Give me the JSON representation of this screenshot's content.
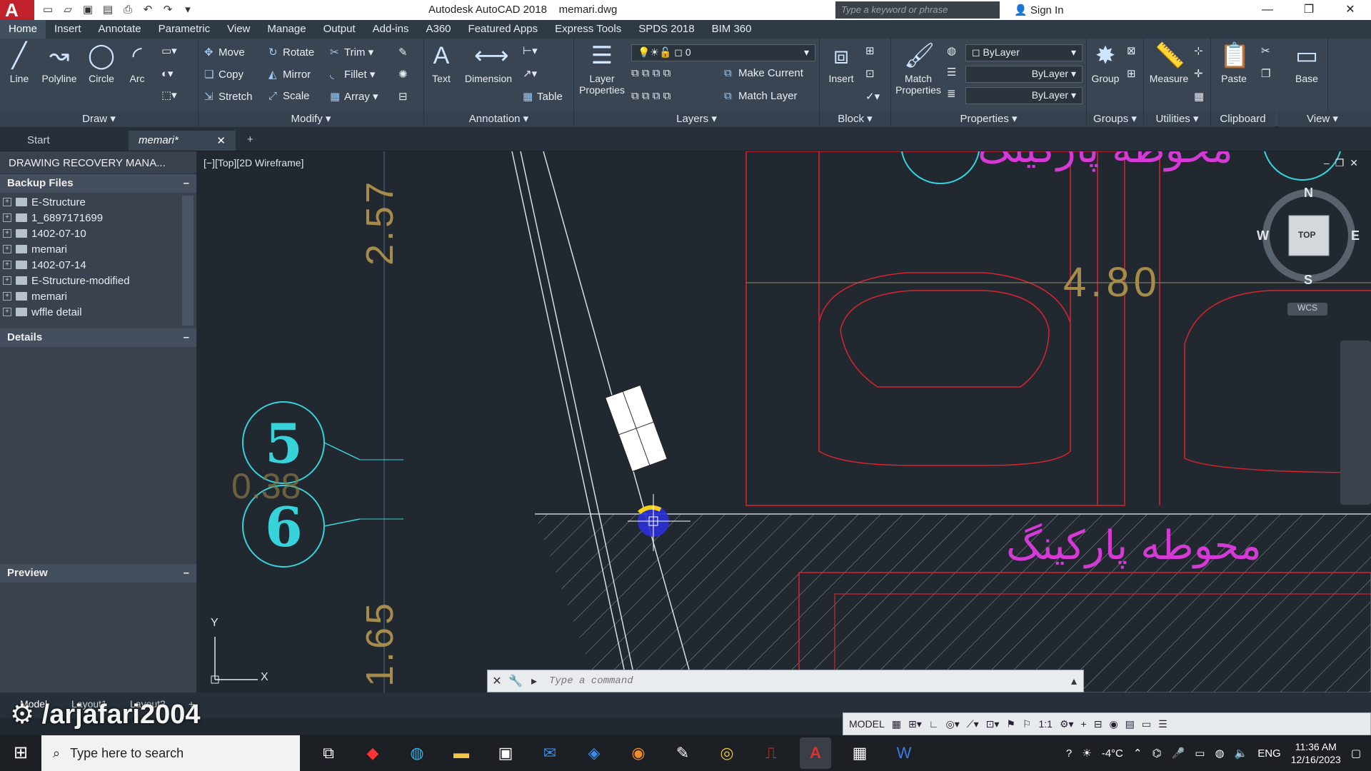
{
  "app": {
    "title": "Autodesk AutoCAD 2018",
    "file": "memari.dwg",
    "logo": "A",
    "search_placeholder": "Type a keyword or phrase",
    "sign_in": "Sign In"
  },
  "menu": [
    "Home",
    "Insert",
    "Annotate",
    "Parametric",
    "View",
    "Manage",
    "Output",
    "Add-ins",
    "A360",
    "Featured Apps",
    "Express Tools",
    "SPDS 2018",
    "BIM 360"
  ],
  "ribbon": {
    "draw": {
      "title": "Draw",
      "line": "Line",
      "polyline": "Polyline",
      "circle": "Circle",
      "arc": "Arc"
    },
    "modify": {
      "title": "Modify",
      "move": "Move",
      "rotate": "Rotate",
      "trim": "Trim",
      "copy": "Copy",
      "mirror": "Mirror",
      "fillet": "Fillet",
      "stretch": "Stretch",
      "scale": "Scale",
      "array": "Array"
    },
    "annotation": {
      "title": "Annotation",
      "text": "Text",
      "dimension": "Dimension",
      "table": "Table"
    },
    "layers": {
      "title": "Layers",
      "layer_properties_1": "Layer",
      "layer_properties_2": "Properties",
      "current_layer": "0",
      "make_current": "Make Current",
      "match_layer": "Match Layer"
    },
    "block": {
      "title": "Block",
      "insert": "Insert"
    },
    "properties": {
      "title": "Properties",
      "match_1": "Match",
      "match_2": "Properties",
      "color": "ByLayer",
      "linetype": "ByLayer",
      "lineweight": "ByLayer"
    },
    "groups": {
      "title": "Groups",
      "group": "Group"
    },
    "utilities": {
      "title": "Utilities",
      "measure": "Measure"
    },
    "clipboard": {
      "title": "Clipboard",
      "paste": "Paste"
    },
    "view": {
      "title": "View",
      "base": "Base"
    }
  },
  "doctabs": {
    "start": "Start",
    "active": "memari*"
  },
  "recovery": {
    "title": "DRAWING RECOVERY MANA...",
    "backup_header": "Backup Files",
    "files": [
      "E-Structure",
      "1_6897171699",
      "1402-07-10",
      "memari",
      "1402-07-14",
      "E-Structure-modified",
      "memari",
      "wffle detail"
    ],
    "details_header": "Details",
    "preview_header": "Preview"
  },
  "viewport": {
    "label": "[−][Top][2D Wireframe]",
    "viewcube": {
      "n": "N",
      "s": "S",
      "e": "E",
      "w": "W",
      "top": "TOP",
      "wcs": "WCS"
    },
    "dim_257": "2.57",
    "dim_480": "4.80",
    "dim_038": "0.38",
    "dim_165": "1.65",
    "marker_5": "5",
    "marker_6": "6",
    "arabic_parking": "محوطه پارکینگ",
    "arabic_parking_top": "محوطه پارکینگ",
    "ucs_y": "Y",
    "ucs_x": "X"
  },
  "command": {
    "placeholder": "Type a command"
  },
  "layouts": {
    "model": "Model",
    "l1": "Layout1",
    "l2": "Layout2"
  },
  "watermark": "/arjafari2004",
  "status": {
    "model": "MODEL",
    "scale": "1:1"
  },
  "taskbar": {
    "search": "Type here to search",
    "temp": "-4°C",
    "lang": "ENG",
    "time": "11:36 AM",
    "date": "12/16/2023"
  }
}
